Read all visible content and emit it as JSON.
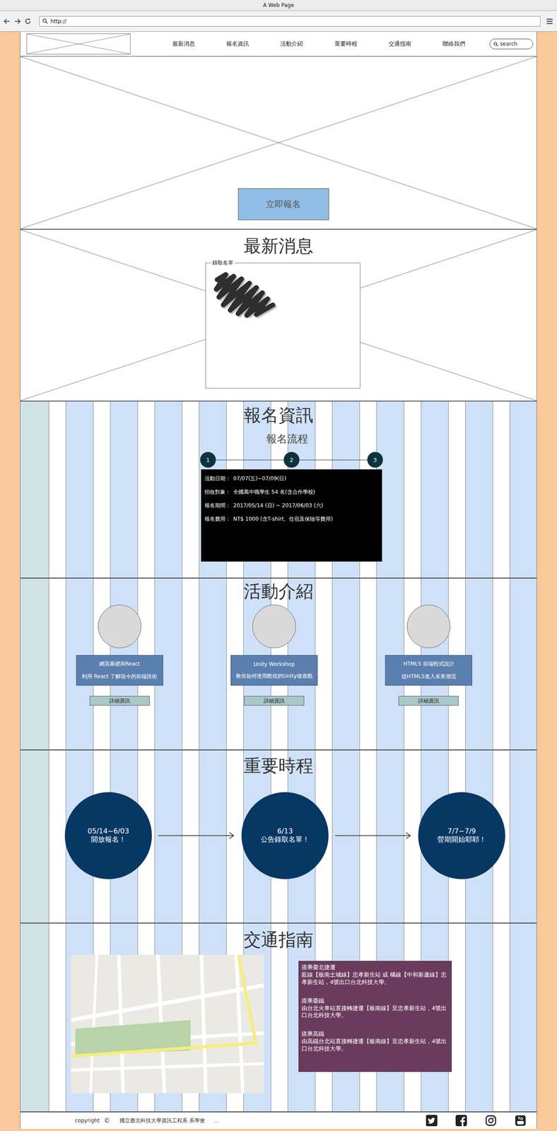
{
  "window": {
    "title": "A Web Page",
    "url": "http://"
  },
  "nav": {
    "items": [
      "最新消息",
      "報名資訊",
      "活動介紹",
      "重要時程",
      "交通指南",
      "聯絡我們"
    ],
    "search_placeholder": "search"
  },
  "hero": {
    "button": "立即報名"
  },
  "news": {
    "title": "最新消息",
    "legend": "錄取名單"
  },
  "registration": {
    "title": "報名資訊",
    "subtitle": "報名流程",
    "steps": [
      "1",
      "2",
      "3"
    ],
    "info": [
      {
        "label": "活動日期：",
        "value": "07/07(五)~07/09(日)"
      },
      {
        "label": "招收對象：",
        "value": "全國高中職學生 54 名(含合作學校)"
      },
      {
        "label": "報名期間：",
        "value": "2017/05/14 (日) ~ 2017/06/03 (六)"
      },
      {
        "label": "報名費用：",
        "value": "NT$ 1000 (含T-shirt、住宿及保險等費用)"
      }
    ]
  },
  "activities": {
    "title": "活動介紹",
    "items": [
      {
        "name": "網頁基礎與React",
        "desc": "利用 React 了解現今的前端技術",
        "button": "詳細資訊"
      },
      {
        "name": "Unity Workshop",
        "desc": "教你如何使用酷炫的Unity做遊戲",
        "button": "詳細資訊"
      },
      {
        "name": "HTML5 前端程式設計",
        "desc": "從HTML5進入未來潮流",
        "button": "詳細資訊"
      }
    ]
  },
  "timeline": {
    "title": "重要時程",
    "events": [
      {
        "date": "05/14~6/03",
        "text": "開放報名！"
      },
      {
        "date": "6/13",
        "text": "公告錄取名單！"
      },
      {
        "date": "7/7~7/9",
        "text": "營期開始耶耶！"
      }
    ]
  },
  "transport": {
    "title": "交通指南",
    "directions": [
      {
        "title": "搭乘臺北捷運",
        "body": "藍線【板南土城線】忠孝新生站 或 橘線【中和新蘆線】忠孝新生站，4號出口台北科技大學。"
      },
      {
        "title": "搭乘臺鐵",
        "body": "由台北火車站直接轉捷運【板南線】至忠孝新生站，4號出口台北科技大學。"
      },
      {
        "title": "搭乘高鐵",
        "body": "由高鐵台北站直接轉捷運【板南線】至忠孝新生站，4號出口台北科技大學。"
      }
    ]
  },
  "footer": {
    "copyright": "copyright",
    "symbol": "©",
    "org": "國立臺北科技大學資訊工程系 系學會",
    "more": "..."
  }
}
